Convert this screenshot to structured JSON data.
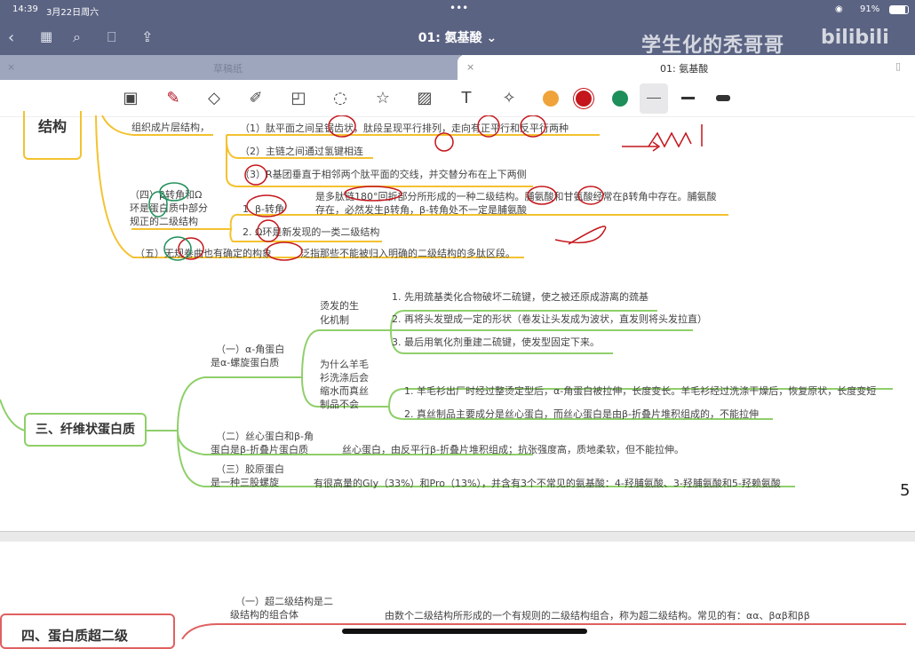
{
  "status": {
    "time": "14:39",
    "date": "3月22日周六",
    "battery": "91%"
  },
  "nav": {
    "title": "01: 氨基酸 ⌄",
    "watermark": "学生化的秃哥哥",
    "logo": "bilibili"
  },
  "tabs": [
    {
      "label": "草稿纸",
      "close": "×"
    },
    {
      "label": "01: 氨基酸",
      "close": "×"
    }
  ],
  "colors": {
    "orange": "#f0a33a",
    "red": "#c4161c",
    "green": "#1e8e5a",
    "yellow_line": "#f4c230",
    "green_line": "#8fcf6a"
  },
  "page1": {
    "box": "结构",
    "partial": "组织成片层结构，",
    "b1": "（1）肽平面之间呈锯齿状，肽段呈现平行排列，走向有正平行和反平行两种",
    "b2": "（2）主链之间通过氢键相连",
    "b3": "（3）R基团垂直于相邻两个肽平面的交线，并交替分布在上下两侧",
    "four": [
      "（四）β转角和Ω",
      "环是蛋白质中部分",
      "规正的二级结构"
    ],
    "beta_label": "1. β-转角",
    "beta_desc1": "是多肽链180°回折部分所形成的一种二级结构。脯氨酸和甘氨酸经常在β转角中存在。脯氨酸",
    "beta_desc2": "存在，必然发生β转角，β-转角处不一定是脯氨酸",
    "omega": "2. Ω环是新发现的一类二级结构",
    "five": "（五）无规卷曲也有确定的构象",
    "five_desc": "泛指那些不能被归入明确的二级结构的多肽区段。",
    "s3_title": "三、纤维状蛋白质",
    "a_title": [
      "（一）α-角蛋白",
      "是α-螺旋蛋白质"
    ],
    "perm": [
      "烫发的生",
      "化机制"
    ],
    "perm_items": [
      "1. 先用巯基类化合物破坏二硫键，使之被还原成游离的巯基",
      "2. 再将头发塑成一定的形状（卷发让头发成为波状，直发则将头发拉直）",
      "3. 最后用氧化剂重建二硫键，使发型固定下来。"
    ],
    "wool": [
      "为什么羊毛",
      "衫洗涤后会",
      "缩水而真丝",
      "制品不会"
    ],
    "wool_items": [
      "1. 羊毛衫出厂时经过整烫定型后，α-角蛋白被拉伸，长度变长。羊毛衫经过洗涤干燥后，恢复原状，长度变短",
      "2. 真丝制品主要成分是丝心蛋白，而丝心蛋白是由β-折叠片堆积组成的，不能拉伸"
    ],
    "b_title": [
      "（二）丝心蛋白和β-角",
      "蛋白是β-折叠片蛋白质"
    ],
    "b_desc": "丝心蛋白，由反平行β-折叠片堆积组成；抗张强度高，质地柔软，但不能拉伸。",
    "c_title": [
      "（三）胶原蛋白",
      "是一种三股螺旋"
    ],
    "c_desc": "有很高量的Gly（33%）和Pro（13%），并含有3个不常见的氨基酸：4-羟脯氨酸、3-羟脯氨酸和5-羟赖氨酸",
    "page_num": "5"
  },
  "page2": {
    "box": "四、蛋白质超二级",
    "one": [
      "（一）超二级结构是二",
      "级结构的组合体"
    ],
    "one_desc": "由数个二级结构所形成的一个有规则的二级结构组合，称为超二级结构。常见的有：αα、βαβ和ββ"
  }
}
